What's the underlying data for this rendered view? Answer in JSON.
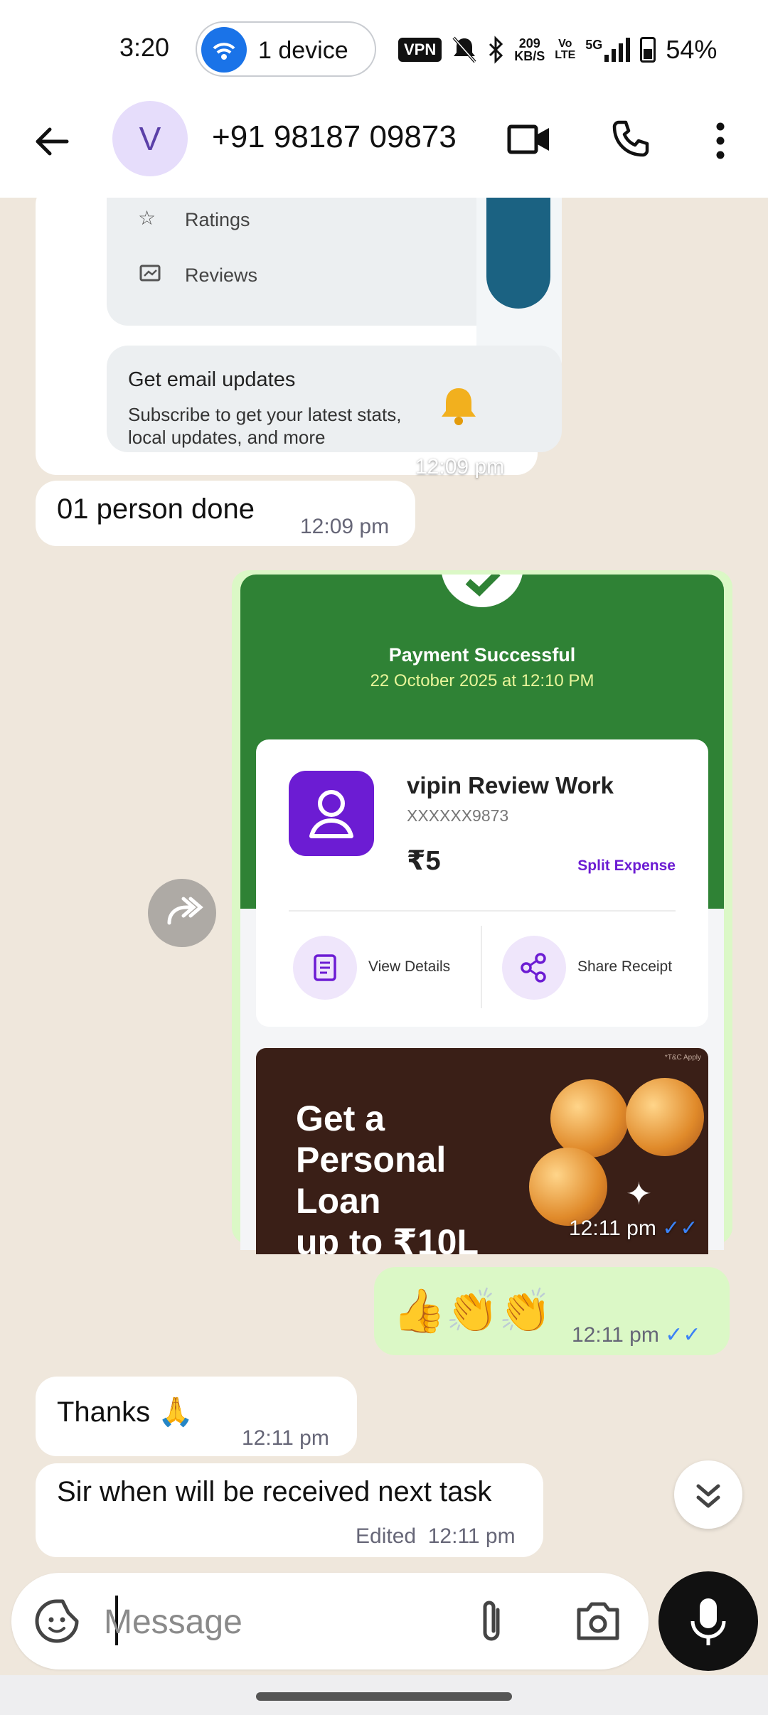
{
  "status_bar": {
    "time": "3:20",
    "hotspot_label": "1 device",
    "vpn": "VPN",
    "speed_value": "209",
    "speed_unit": "KB/S",
    "volte_top": "Vo",
    "volte_bottom": "LTE",
    "network": "5G",
    "battery": "54%"
  },
  "header": {
    "avatar_letter": "V",
    "contact": "+91 98187 09873"
  },
  "messages": {
    "google_card": {
      "ratings": "Ratings",
      "reviews": "Reviews",
      "email_title": "Get email updates",
      "email_line1": "Subscribe to get your latest stats,",
      "email_line2": "local updates, and more",
      "time": "12:09 pm"
    },
    "person_done": {
      "text": "01 person done",
      "time": "12:09 pm"
    },
    "payment": {
      "status": "Payment Successful",
      "datetime": "22 October 2025 at 12:10 PM",
      "payee": "vipin Review Work",
      "account": "XXXXXX9873",
      "amount": "₹5",
      "split": "Split Expense",
      "view_details": "View Details",
      "share_receipt": "Share Receipt",
      "tc": "*T&C Apply",
      "loan_text": "Get a\nPersonal\nLoan\nup to ₹10L",
      "time": "12:11 pm"
    },
    "emoji_msg": {
      "text": "👍👏👏",
      "time": "12:11 pm"
    },
    "thanks": {
      "text": "Thanks 🙏",
      "time": "12:11 pm"
    },
    "next_task": {
      "text": "Sir when will be received next task",
      "edited": "Edited",
      "time": "12:11 pm"
    }
  },
  "composer": {
    "placeholder": "Message"
  },
  "colors": {
    "chat_bg": "#efe7dc",
    "outgoing": "#dbf8c6",
    "payment_green": "#2f8235",
    "phonepe_purple": "#6c1cd3",
    "read_ticks": "#3b82f6"
  }
}
